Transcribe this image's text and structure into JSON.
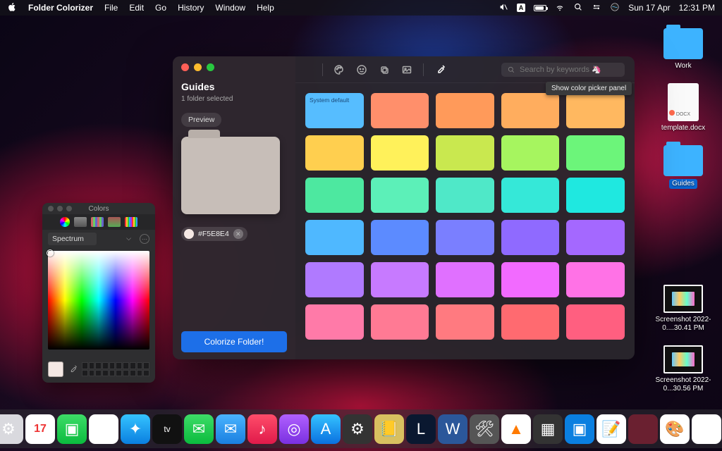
{
  "menubar": {
    "app_name": "Folder Colorizer",
    "items": [
      "File",
      "Edit",
      "Go",
      "History",
      "Window",
      "Help"
    ],
    "lang_indicator": "A",
    "date": "Sun 17 Apr",
    "time": "12:31 PM"
  },
  "desktop": {
    "icons": [
      {
        "type": "folder",
        "label": "Work"
      },
      {
        "type": "doc",
        "label": "template.docx",
        "badge": true,
        "doc_ext": "DOCX"
      },
      {
        "type": "folder",
        "label": "Guides",
        "selected": true
      },
      {
        "type": "shot",
        "label": "Screenshot 2022-0....30.41 PM"
      },
      {
        "type": "shot",
        "label": "Screenshot 2022-0...30.56 PM"
      }
    ]
  },
  "app": {
    "title": "Guides",
    "subtitle": "1 folder selected",
    "preview_label": "Preview",
    "hex_value": "#F5E8E4",
    "colorize_button": "Colorize Folder!",
    "search_placeholder": "Search by keywords 🦄",
    "tooltip": "Show color picker panel",
    "default_swatch_label": "System default",
    "swatches": [
      "#56bdff",
      "#ff8f6b",
      "#ff9a5a",
      "#ffad5e",
      "#ffb860",
      "#ffcf4f",
      "#fff15a",
      "#c9e84f",
      "#a6f55f",
      "#6cf57a",
      "#4de8a0",
      "#5cf0b8",
      "#4fe8c8",
      "#35e8d8",
      "#1fe8e0",
      "#4fb8ff",
      "#5c8bff",
      "#7a7fff",
      "#8f6aff",
      "#a468ff",
      "#b07aff",
      "#c77aff",
      "#e070ff",
      "#f26aff",
      "#ff72e6",
      "#ff7aa8",
      "#ff7a94",
      "#ff7a80",
      "#ff6a70",
      "#ff5f80"
    ]
  },
  "color_panel": {
    "title": "Colors",
    "mode": "Spectrum",
    "current_hex": "#F5E8E4"
  },
  "dock": {
    "items": [
      {
        "name": "finder",
        "bg": "linear-gradient(#4ab4ff,#1a7fe0)",
        "glyph": "☺"
      },
      {
        "name": "launchpad",
        "bg": "#e8e8ec",
        "glyph": "▦"
      },
      {
        "name": "settings",
        "bg": "#d9d9de",
        "glyph": "⚙"
      },
      {
        "name": "calendar",
        "bg": "#fff",
        "glyph": "17"
      },
      {
        "name": "facetime",
        "bg": "linear-gradient(#3ddc67,#0bbb3e)",
        "glyph": "▣"
      },
      {
        "name": "chrome",
        "bg": "#fff",
        "glyph": "◉"
      },
      {
        "name": "safari",
        "bg": "linear-gradient(#35c3ff,#0a7fe0)",
        "glyph": "✦"
      },
      {
        "name": "appletv",
        "bg": "#111",
        "glyph": "tv"
      },
      {
        "name": "messages",
        "bg": "linear-gradient(#3ddc67,#0bbb3e)",
        "glyph": "✉"
      },
      {
        "name": "mail",
        "bg": "linear-gradient(#4ab4ff,#1a7fe0)",
        "glyph": "✉"
      },
      {
        "name": "music",
        "bg": "linear-gradient(#ff4d6a,#e01a4a)",
        "glyph": "♪"
      },
      {
        "name": "podcasts",
        "bg": "linear-gradient(#b060ff,#7a30e0)",
        "glyph": "◎"
      },
      {
        "name": "appstore",
        "bg": "linear-gradient(#35c3ff,#0a70e0)",
        "glyph": "A"
      },
      {
        "name": "sysprefs",
        "bg": "#333",
        "glyph": "⚙"
      },
      {
        "name": "notes2",
        "bg": "#d8c060",
        "glyph": "📒"
      },
      {
        "name": "league",
        "bg": "#0a1830",
        "glyph": "L"
      },
      {
        "name": "word",
        "bg": "#2b579a",
        "glyph": "W"
      },
      {
        "name": "utility",
        "bg": "#555",
        "glyph": "🛠"
      },
      {
        "name": "vlc",
        "bg": "#fff",
        "glyph": "▲"
      },
      {
        "name": "calc",
        "bg": "#333",
        "glyph": "▦"
      },
      {
        "name": "zoom",
        "bg": "#0a7fe0",
        "glyph": "▣"
      },
      {
        "name": "notes",
        "bg": "#fff",
        "glyph": "📝"
      },
      {
        "name": "folder1",
        "bg": "#6a2030",
        "glyph": ""
      },
      {
        "name": "colorizer",
        "bg": "#fff",
        "glyph": "🎨"
      },
      {
        "name": "preview2",
        "bg": "#fff",
        "glyph": "🖼"
      }
    ],
    "right": [
      {
        "name": "downloads",
        "bg": "#3db3ff",
        "glyph": "↓"
      },
      {
        "name": "trash",
        "bg": "rgba(255,255,255,0.15)",
        "glyph": "🗑"
      }
    ]
  }
}
